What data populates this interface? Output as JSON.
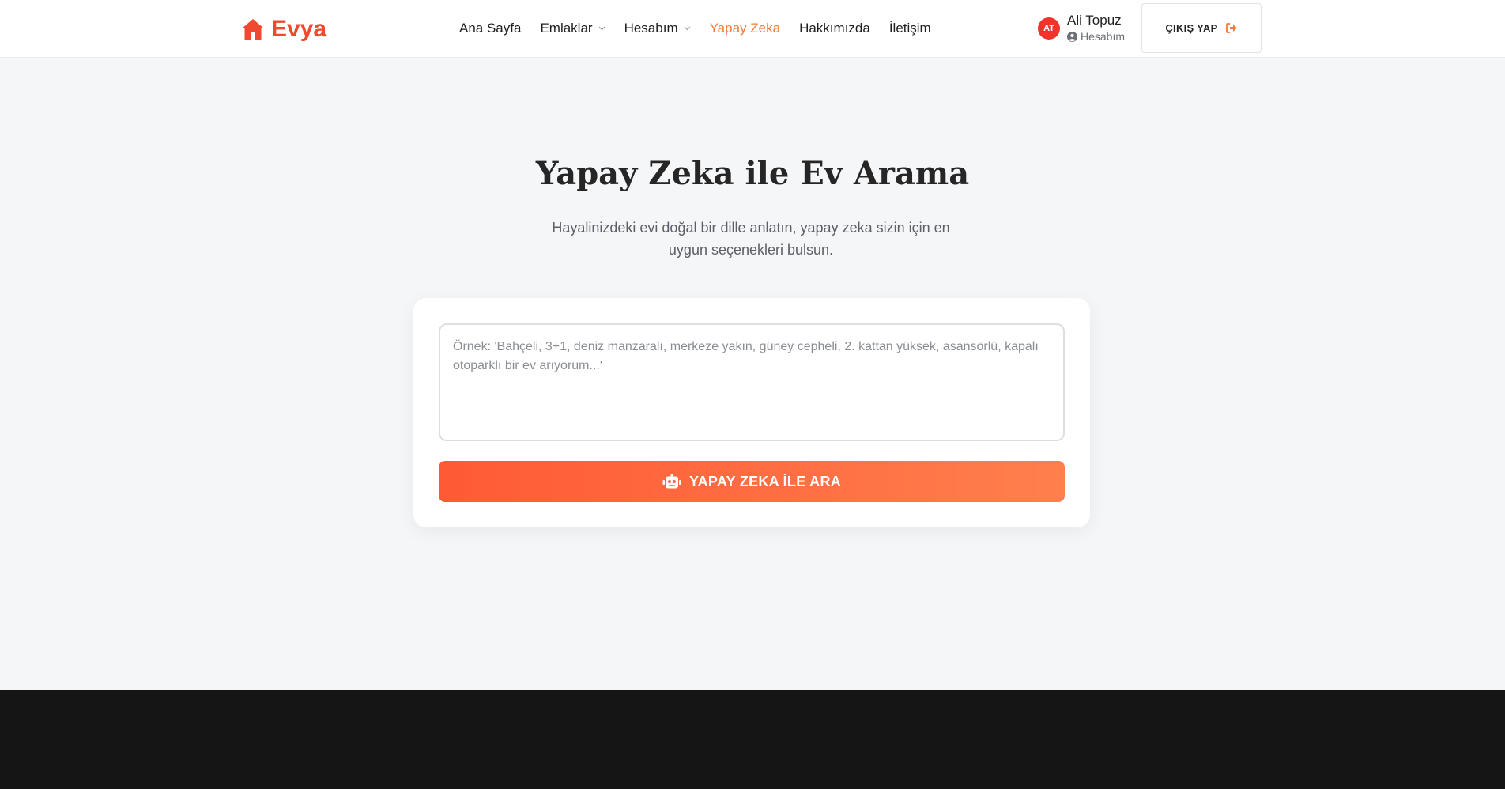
{
  "brand": {
    "name": "Evya",
    "icon": "home-icon",
    "color": "#f0492f"
  },
  "nav": {
    "items": [
      {
        "label": "Ana Sayfa",
        "dropdown": false,
        "active": false
      },
      {
        "label": "Emlaklar",
        "dropdown": true,
        "active": false
      },
      {
        "label": "Hesabım",
        "dropdown": true,
        "active": false
      },
      {
        "label": "Yapay Zeka",
        "dropdown": false,
        "active": true
      },
      {
        "label": "Hakkımızda",
        "dropdown": false,
        "active": false
      },
      {
        "label": "İletişim",
        "dropdown": false,
        "active": false
      }
    ],
    "active_color": "#f27a3a"
  },
  "user": {
    "initials": "AT",
    "name": "Ali Topuz",
    "account_label": "Hesabım",
    "account_icon": "user-circle-icon"
  },
  "logout": {
    "label": "ÇIKIŞ YAP",
    "icon": "sign-out-icon"
  },
  "hero": {
    "title": "Yapay Zeka ile Ev Arama",
    "subtitle": "Hayalinizdeki evi doğal bir dille anlatın, yapay zeka sizin için en uygun seçenekleri bulsun."
  },
  "search": {
    "placeholder": "Örnek: 'Bahçeli, 3+1, deniz manzaralı, merkeze yakın, güney cepheli, 2. kattan yüksek, asansörlü, kapalı otoparklı bir ev arıyorum...'",
    "value": "",
    "button_label": "YAPAY ZEKA İLE ARA",
    "button_icon": "robot-icon",
    "button_gradient": [
      "#ff5a36",
      "#ff7f4d"
    ]
  }
}
